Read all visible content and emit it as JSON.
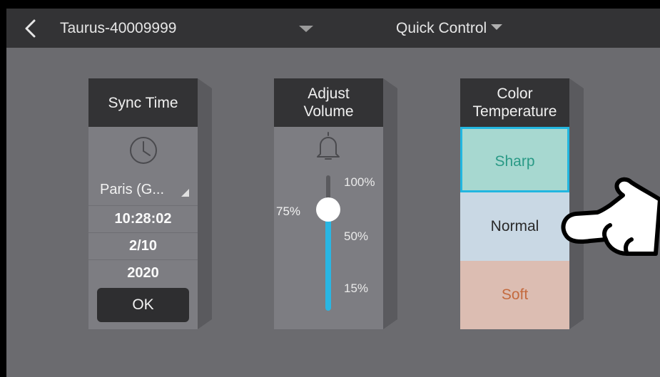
{
  "header": {
    "back_icon": "chevron-left-icon",
    "device_name": "Taurus-40009999",
    "center_dropdown_icon": "triangle-down-icon",
    "mode_label": "Quick Control",
    "mode_dropdown_icon": "triangle-down-icon"
  },
  "sync_time": {
    "title": "Sync Time",
    "icon": "clock-icon",
    "city": "Paris (G...",
    "time": "10:28:02",
    "date": "2/10",
    "year": "2020",
    "ok_label": "OK"
  },
  "volume": {
    "title_line1": "Adjust",
    "title_line2": "Volume",
    "icon": "bell-icon",
    "current_label": "75%",
    "current_value": 75,
    "marks": [
      "100%",
      "50%",
      "15%"
    ],
    "accent_color": "#29b6e3"
  },
  "color_temperature": {
    "title_line1": "Color",
    "title_line2": "Temperature",
    "options": [
      "Sharp",
      "Normal",
      "Soft"
    ],
    "selected": "Sharp",
    "colors": {
      "sharp": "#a7d8d0",
      "normal": "#c9d8e4",
      "soft": "#dcbdb2",
      "highlight": "#22b6e0"
    }
  },
  "overlay": {
    "pointer_icon": "pointing-hand-icon"
  }
}
